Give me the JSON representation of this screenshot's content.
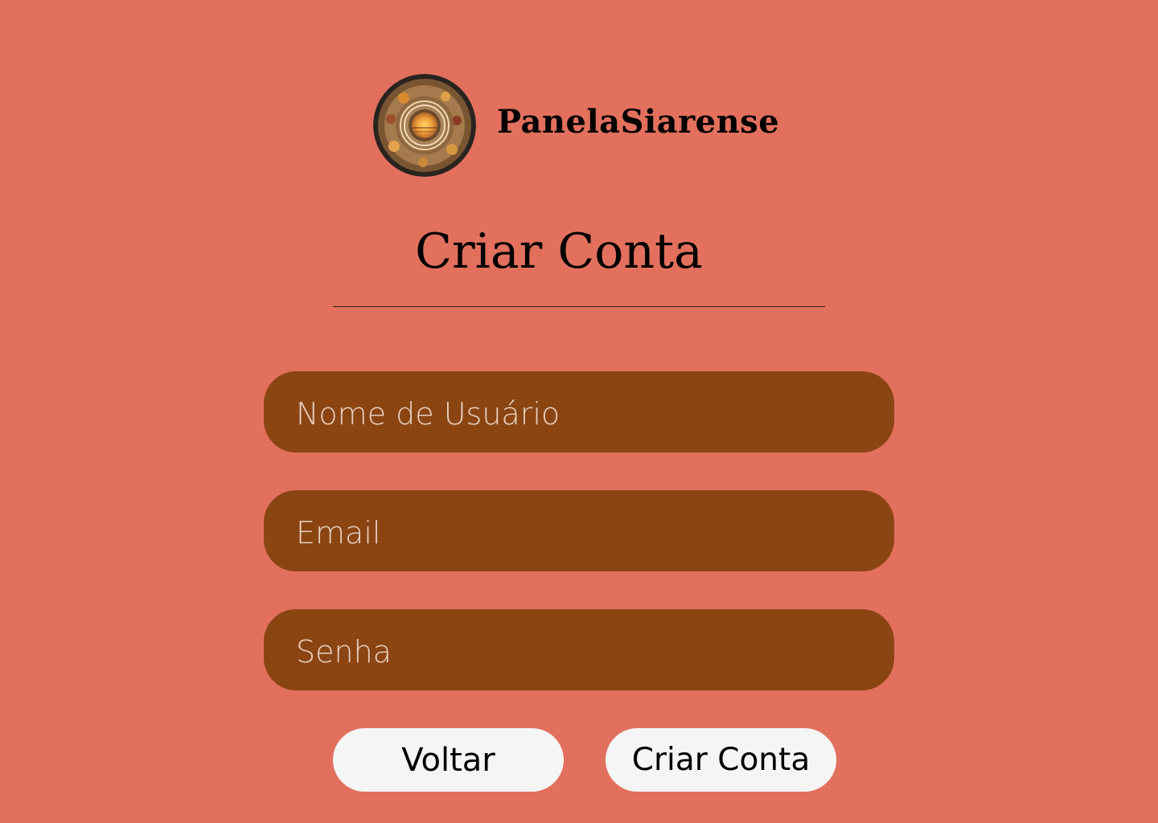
{
  "header": {
    "logo_icon": "sunset-plate-logo-icon",
    "brand_name": "PanelaSiarense"
  },
  "page": {
    "title": "Criar Conta"
  },
  "form": {
    "username_placeholder": "Nome de Usuário",
    "email_placeholder": "Email",
    "password_placeholder": "Senha",
    "back_label": "Voltar",
    "create_label": "Criar Conta"
  },
  "colors": {
    "background": "#e2705d",
    "field": "#8b4513",
    "button": "#f5f5f5"
  }
}
